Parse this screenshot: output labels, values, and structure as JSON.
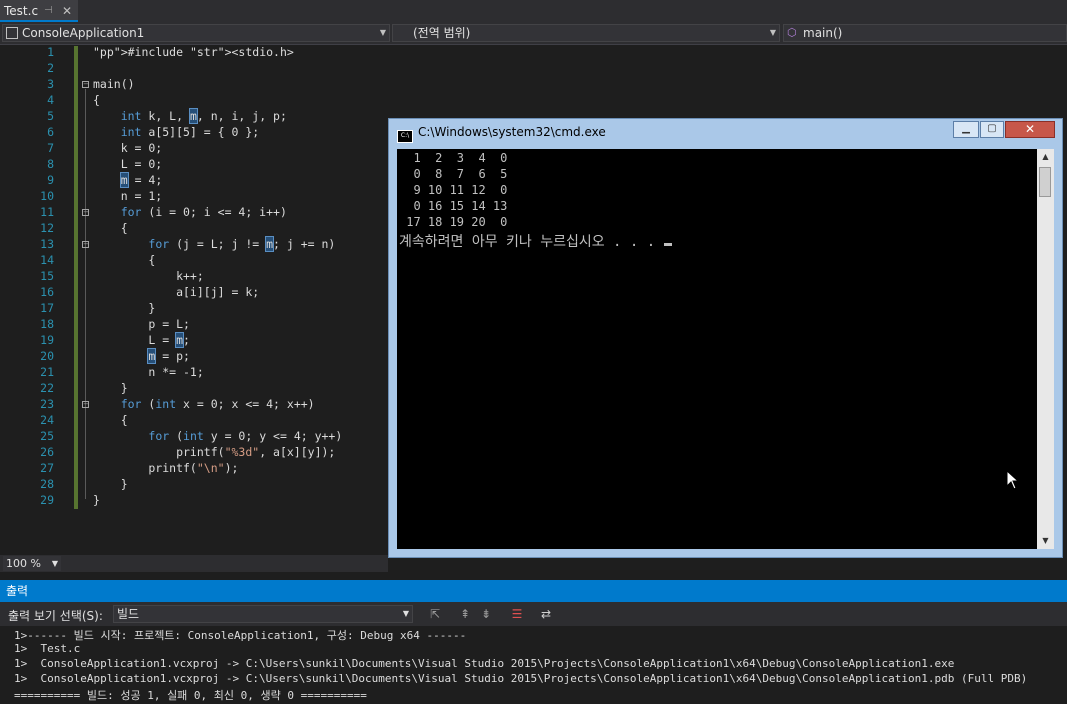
{
  "tab": {
    "title": "Test.c",
    "pin": "⊣",
    "close": "✕"
  },
  "nav": {
    "project": "ConsoleApplication1",
    "scope": "(전역 범위)",
    "member": "main()"
  },
  "line_numbers": [
    "1",
    "2",
    "3",
    "4",
    "5",
    "6",
    "7",
    "8",
    "9",
    "10",
    "11",
    "12",
    "13",
    "14",
    "15",
    "16",
    "17",
    "18",
    "19",
    "20",
    "21",
    "22",
    "23",
    "24",
    "25",
    "26",
    "27",
    "28",
    "29"
  ],
  "code": [
    "#include <stdio.h>",
    "",
    "main()",
    "{",
    "    int k, L, m, n, i, j, p;",
    "    int a[5][5] = { 0 };",
    "    k = 0;",
    "    L = 0;",
    "    m = 4;",
    "    n = 1;",
    "    for (i = 0; i <= 4; i++)",
    "    {",
    "        for (j = L; j != m; j += n)",
    "        {",
    "            k++;",
    "            a[i][j] = k;",
    "        }",
    "        p = L;",
    "        L = m;",
    "        m = p;",
    "        n *= -1;",
    "    }",
    "    for (int x = 0; x <= 4; x++)",
    "    {",
    "        for (int y = 0; y <= 4; y++)",
    "            printf(\"%3d\", a[x][y]);",
    "        printf(\"\\n\");",
    "    }",
    "}"
  ],
  "zoom": "100 %",
  "cmd": {
    "title": "C:\\Windows\\system32\\cmd.exe",
    "lines": [
      "  1  2  3  4  0",
      "  0  8  7  6  5",
      "  9 10 11 12  0",
      "  0 16 15 14 13",
      " 17 18 19 20  0",
      "계속하려면 아무 키나 누르십시오 . . . "
    ]
  },
  "output": {
    "header": "출력",
    "label": "출력 보기 선택(S):",
    "source": "빌드",
    "lines": [
      "1>------ 빌드 시작: 프로젝트: ConsoleApplication1, 구성: Debug x64 ------",
      "1>  Test.c",
      "1>  ConsoleApplication1.vcxproj -> C:\\Users\\sunkil\\Documents\\Visual Studio 2015\\Projects\\ConsoleApplication1\\x64\\Debug\\ConsoleApplication1.exe",
      "1>  ConsoleApplication1.vcxproj -> C:\\Users\\sunkil\\Documents\\Visual Studio 2015\\Projects\\ConsoleApplication1\\x64\\Debug\\ConsoleApplication1.pdb (Full PDB)",
      "========== 빌드: 성공 1, 실패 0, 최신 0, 생략 0 =========="
    ]
  }
}
